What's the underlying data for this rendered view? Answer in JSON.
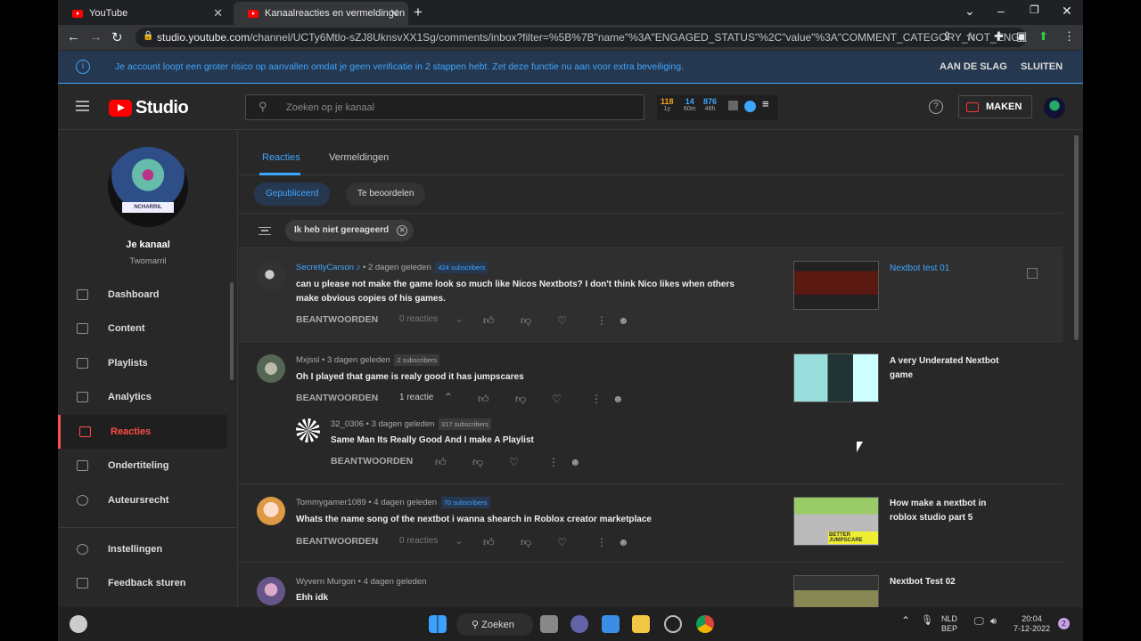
{
  "browser": {
    "tabs": [
      {
        "title": "YouTube"
      },
      {
        "title": "Kanaalreacties en vermeldingen"
      }
    ],
    "url_host": "studio.youtube.com",
    "url_path": "/channel/UCTy6Mtlo-sZJ8UknsvXX1Sg/comments/inbox?filter=%5B%7B\"name\"%3A\"ENGAGED_STATUS\"%2C\"value\"%3A\"COMMENT_CATEGORY_NOT_ENG..."
  },
  "banner": {
    "message": "Je account loopt een groter risico op aanvallen omdat je geen verificatie in 2 stappen hebt. Zet deze functie nu aan voor extra beveiliging.",
    "action_start": "AAN DE SLAG",
    "action_close": "SLUITEN"
  },
  "header": {
    "logo_text": "Studio",
    "search_placeholder": "Zoeken op je kanaal",
    "stats": [
      {
        "value": "118",
        "label": "1y",
        "color": "#f5a623"
      },
      {
        "value": "14",
        "label": "60m",
        "color": "#3ea6ff"
      },
      {
        "value": "876",
        "label": "48h",
        "color": "#3ea6ff"
      }
    ],
    "create_label": "MAKEN"
  },
  "sidebar": {
    "avatar_badge": "NCHARRIL",
    "channel_title": "Je kanaal",
    "channel_name": "Twomarril",
    "items": [
      {
        "label": "Dashboard"
      },
      {
        "label": "Content"
      },
      {
        "label": "Playlists"
      },
      {
        "label": "Analytics"
      },
      {
        "label": "Reacties"
      },
      {
        "label": "Ondertiteling"
      },
      {
        "label": "Auteursrecht"
      },
      {
        "label": "Instellingen"
      },
      {
        "label": "Feedback sturen"
      }
    ]
  },
  "main": {
    "tabs": [
      {
        "label": "Reacties"
      },
      {
        "label": "Vermeldingen"
      }
    ],
    "chips": [
      {
        "label": "Gepubliceerd"
      },
      {
        "label": "Te beoordelen"
      }
    ],
    "filter_chip": "Ik heb niet gereageerd",
    "reply_label": "BEANTWOORDEN",
    "comments": [
      {
        "author": "SecretlyCarson ♪",
        "time": "• 2 dagen geleden",
        "subscribers": "424 subscribers",
        "text": "can u please not make the game look so much like Nicos Nextbots? I don't think Nico likes when others make obvious copies of his games.",
        "replies": "0 reacties",
        "video_title": "Nextbot test 01"
      },
      {
        "author": "Mxjssl",
        "time": "• 3 dagen geleden",
        "subscribers": "2 subscribers",
        "text": "Oh I played that game is realy good it has jumpscares",
        "replies": "1 reactie",
        "video_title": "A very Underated Nextbot game",
        "reply": {
          "author": "32_0306",
          "time": "• 3 dagen geleden",
          "subscribers": "317 subscribers",
          "text": "Same Man Its Really Good And I make A Playlist"
        }
      },
      {
        "author": "Tommygamer1089",
        "time": "• 4 dagen geleden",
        "subscribers": "70 subscribers",
        "text": "Whats the name song of the nextbot i wanna shearch in Roblox creator marketplace",
        "replies": "0 reacties",
        "video_title": "How make a nextbot in roblox studio part 5",
        "thumb_caption": "BETTER JUMPSCARE"
      },
      {
        "author": "Wyvern Murgon",
        "time": "• 4 dagen geleden",
        "text": "Ehh idk",
        "video_title": "Nextbot Test 02"
      }
    ]
  },
  "taskbar": {
    "search_label": "Zoeken",
    "lang": "NLD",
    "kbd": "BEP",
    "time": "20:04",
    "date": "7-12-2022",
    "notif_count": "2"
  }
}
